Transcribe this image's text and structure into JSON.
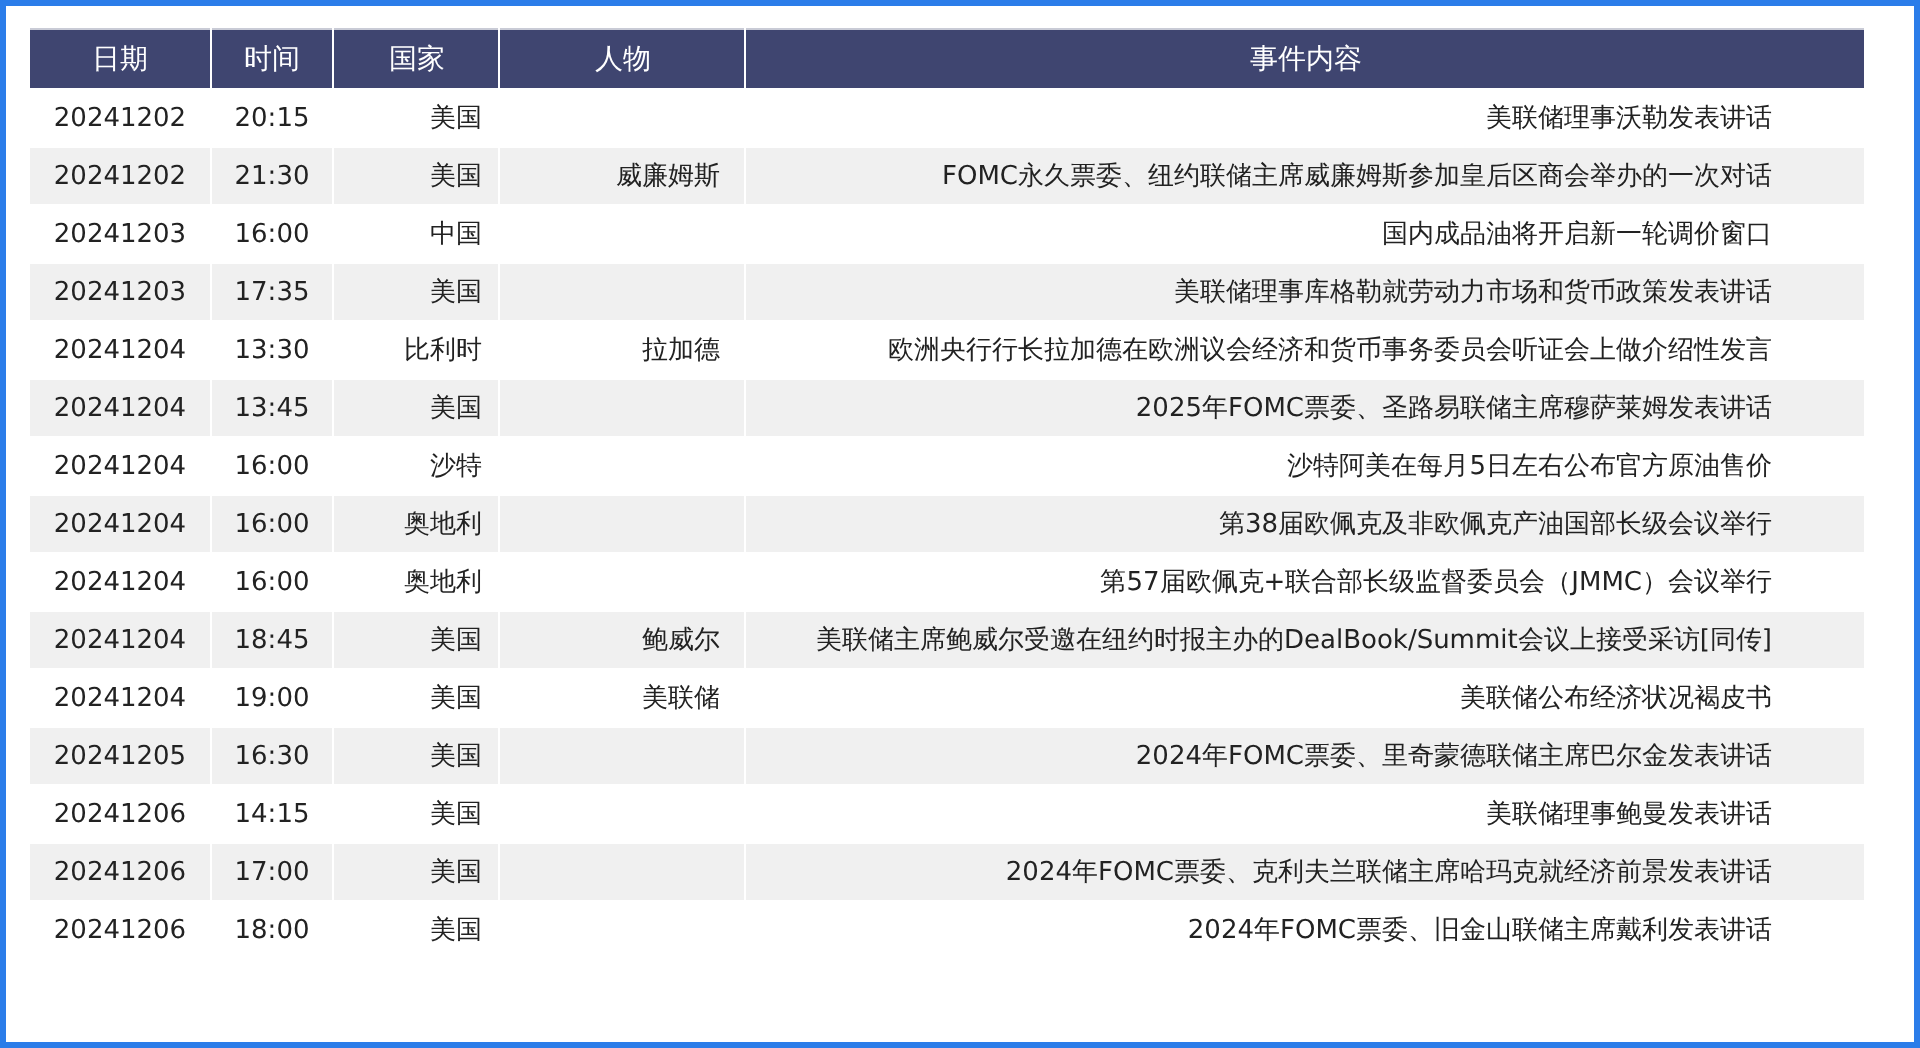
{
  "table": {
    "columns": [
      "日期",
      "时间",
      "国家",
      "人物",
      "事件内容"
    ],
    "rows": [
      {
        "date": "20241202",
        "time": "20:15",
        "country": "美国",
        "event": "美联储理事沃勒发表讲话"
      },
      {
        "date": "20241202",
        "time": "21:30",
        "country": "美国",
        "person": "威廉姆斯",
        "event": "FOMC永久票委、纽约联储主席威廉姆斯参加皇后区商会举办的一次对话"
      },
      {
        "date": "20241203",
        "time": "16:00",
        "country": "中国",
        "event": "国内成品油将开启新一轮调价窗口"
      },
      {
        "date": "20241203",
        "time": "17:35",
        "country": "美国",
        "event": "美联储理事库格勒就劳动力市场和货币政策发表讲话"
      },
      {
        "date": "20241204",
        "time": "13:30",
        "country": "比利时",
        "person": "拉加德",
        "event": "欧洲央行行长拉加德在欧洲议会经济和货币事务委员会听证会上做介绍性发言"
      },
      {
        "date": "20241204",
        "time": "13:45",
        "country": "美国",
        "event": "2025年FOMC票委、圣路易联储主席穆萨莱姆发表讲话"
      },
      {
        "date": "20241204",
        "time": "16:00",
        "country": "沙特",
        "event": "沙特阿美在每月5日左右公布官方原油售价"
      },
      {
        "date": "20241204",
        "time": "16:00",
        "country": "奥地利",
        "event": "第38届欧佩克及非欧佩克产油国部长级会议举行"
      },
      {
        "date": "20241204",
        "time": "16:00",
        "country": "奥地利",
        "event": "第57届欧佩克+联合部长级监督委员会（JMMC）会议举行"
      },
      {
        "date": "20241204",
        "time": "18:45",
        "country": "美国",
        "person": "鲍威尔",
        "event": "美联储主席鲍威尔受邀在纽约时报主办的DealBook/Summit会议上接受采访[同传]"
      },
      {
        "date": "20241204",
        "time": "19:00",
        "country": "美国",
        "person": "美联储",
        "event": "美联储公布经济状况褐皮书"
      },
      {
        "date": "20241205",
        "time": "16:30",
        "country": "美国",
        "event": "2024年FOMC票委、里奇蒙德联储主席巴尔金发表讲话"
      },
      {
        "date": "20241206",
        "time": "14:15",
        "country": "美国",
        "event": "美联储理事鲍曼发表讲话"
      },
      {
        "date": "20241206",
        "time": "17:00",
        "country": "美国",
        "event": "2024年FOMC票委、克利夫兰联储主席哈玛克就经济前景发表讲话"
      },
      {
        "date": "20241206",
        "time": "18:00",
        "country": "美国",
        "event": "2024年FOMC票委、旧金山联储主席戴利发表讲话"
      }
    ]
  }
}
